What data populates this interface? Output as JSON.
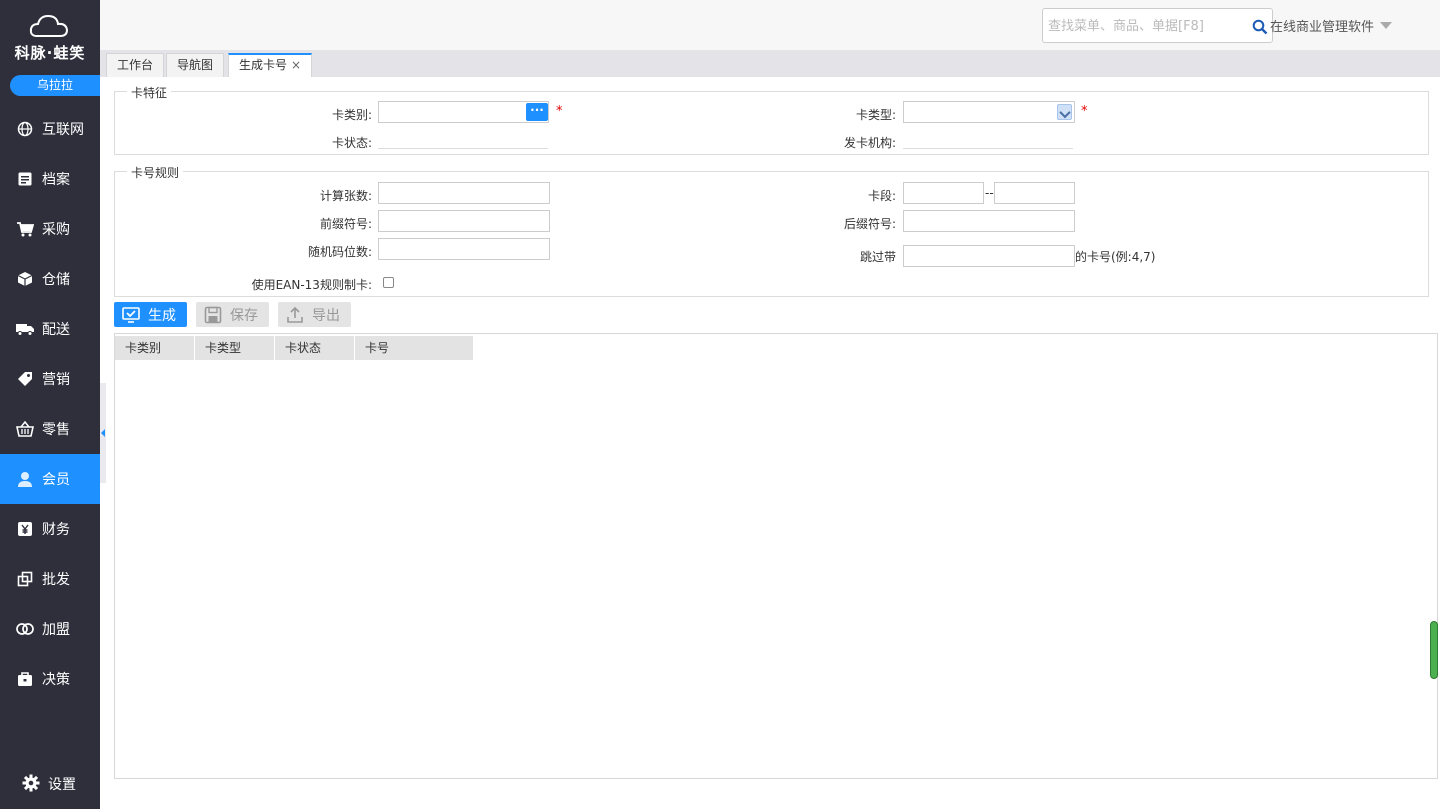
{
  "sidebar": {
    "brand": "科脉·蛙笑",
    "user": "乌拉拉",
    "items": [
      {
        "label": "互联网",
        "icon": "globe-icon"
      },
      {
        "label": "档案",
        "icon": "document-icon"
      },
      {
        "label": "采购",
        "icon": "cart-icon"
      },
      {
        "label": "仓储",
        "icon": "box-icon"
      },
      {
        "label": "配送",
        "icon": "truck-icon"
      },
      {
        "label": "营销",
        "icon": "tag-icon"
      },
      {
        "label": "零售",
        "icon": "basket-icon"
      },
      {
        "label": "会员",
        "icon": "person-icon"
      },
      {
        "label": "财务",
        "icon": "yuan-icon"
      },
      {
        "label": "批发",
        "icon": "copy-icon"
      },
      {
        "label": "加盟",
        "icon": "rings-icon"
      },
      {
        "label": "决策",
        "icon": "briefcase-icon"
      }
    ],
    "active_index": 7,
    "settings_label": "设置"
  },
  "topbar": {
    "search_placeholder": "查找菜单、商品、单据[F8]",
    "company": "在线商业管理软件"
  },
  "tabs": [
    {
      "label": "工作台"
    },
    {
      "label": "导航图"
    },
    {
      "label": "生成卡号",
      "close": "×"
    }
  ],
  "card_features": {
    "legend": "卡特征",
    "card_category_label": "卡类别:",
    "card_category_btn": "···",
    "card_type_label": "卡类型:",
    "card_status_label": "卡状态:",
    "issuer_label": "发卡机构:",
    "required_mark": "*"
  },
  "card_rules": {
    "legend": "卡号规则",
    "count_label": "计算张数:",
    "prefix_label": "前缀符号:",
    "random_digits_label": "随机码位数:",
    "ean13_label": "使用EAN-13规则制卡:",
    "segment_label": "卡段:",
    "segment_sep": "--",
    "suffix_label": "后缀符号:",
    "skip_label": "跳过带",
    "skip_suffix": "的卡号(例:4,7)"
  },
  "toolbar": {
    "generate": "生成",
    "save": "保存",
    "export": "导出"
  },
  "grid": {
    "columns": [
      "卡类别",
      "卡类型",
      "卡状态",
      "卡号"
    ]
  }
}
